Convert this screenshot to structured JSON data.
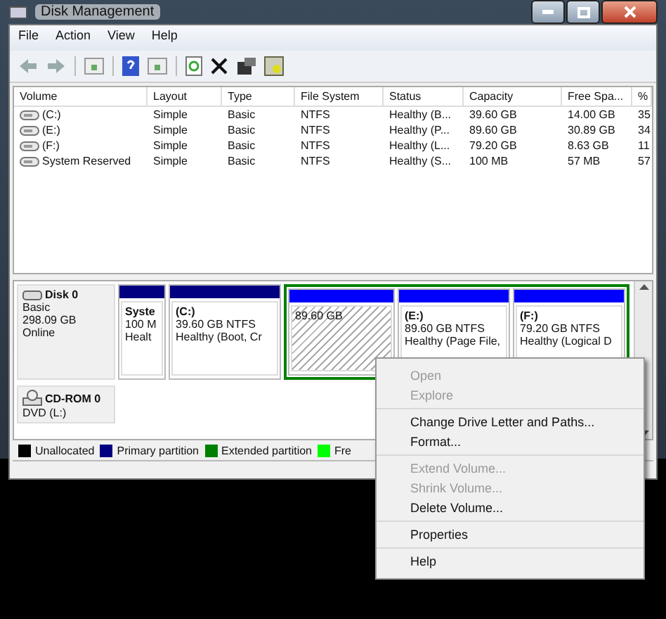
{
  "window": {
    "title": "Disk Management"
  },
  "menu_bar": [
    "File",
    "Action",
    "View",
    "Help"
  ],
  "table": {
    "columns": [
      "Volume",
      "Layout",
      "Type",
      "File System",
      "Status",
      "Capacity",
      "Free Spa...",
      "%"
    ],
    "rows": [
      [
        "(C:)",
        "Simple",
        "Basic",
        "NTFS",
        "Healthy (B...",
        "39.60 GB",
        "14.00 GB",
        "35"
      ],
      [
        "(E:)",
        "Simple",
        "Basic",
        "NTFS",
        "Healthy (P...",
        "89.60 GB",
        "30.89 GB",
        "34"
      ],
      [
        "(F:)",
        "Simple",
        "Basic",
        "NTFS",
        "Healthy (L...",
        "79.20 GB",
        "8.63 GB",
        "11"
      ],
      [
        "System Reserved",
        "Simple",
        "Basic",
        "NTFS",
        "Healthy (S...",
        "100 MB",
        "57 MB",
        "57"
      ]
    ]
  },
  "disks": [
    {
      "name": "Disk 0",
      "kind": "disk",
      "lines": [
        "Basic",
        "298.09 GB",
        "Online"
      ],
      "partitions": [
        {
          "kind": "primary",
          "title": "Syste",
          "lines": [
            "100 M",
            "Healt"
          ],
          "extended": false
        },
        {
          "kind": "primary",
          "title": "(C:)",
          "lines": [
            "39.60 GB NTFS",
            "Healthy (Boot, Cr"
          ],
          "extended": false
        },
        {
          "kind": "unallocated",
          "lines": [
            "89.60 GB"
          ],
          "extended": true
        },
        {
          "kind": "logical",
          "title": "(E:)",
          "lines": [
            "89.60 GB NTFS",
            "Healthy (Page File,"
          ],
          "extended": true
        },
        {
          "kind": "logical",
          "title": "(F:)",
          "lines": [
            "79.20 GB NTFS",
            "Healthy (Logical D"
          ],
          "extended": true
        }
      ]
    },
    {
      "name": "CD-ROM 0",
      "kind": "cdrom",
      "lines": [
        "DVD (L:)"
      ]
    }
  ],
  "legend": [
    {
      "label": "Unallocated",
      "color": "#000000"
    },
    {
      "label": "Primary partition",
      "color": "#000080"
    },
    {
      "label": "Extended partition",
      "color": "#008000"
    },
    {
      "label": "Fre",
      "color": "#00ff00"
    }
  ],
  "context_menu": [
    [
      {
        "label": "Open",
        "disabled": true
      },
      {
        "label": "Explore",
        "disabled": true
      }
    ],
    [
      {
        "label": "Change Drive Letter and Paths...",
        "disabled": false
      },
      {
        "label": "Format...",
        "disabled": false
      }
    ],
    [
      {
        "label": "Extend Volume...",
        "disabled": true
      },
      {
        "label": "Shrink Volume...",
        "disabled": true
      },
      {
        "label": "Delete Volume...",
        "disabled": false
      }
    ],
    [
      {
        "label": "Properties",
        "disabled": false
      }
    ],
    [
      {
        "label": "Help",
        "disabled": false
      }
    ]
  ]
}
